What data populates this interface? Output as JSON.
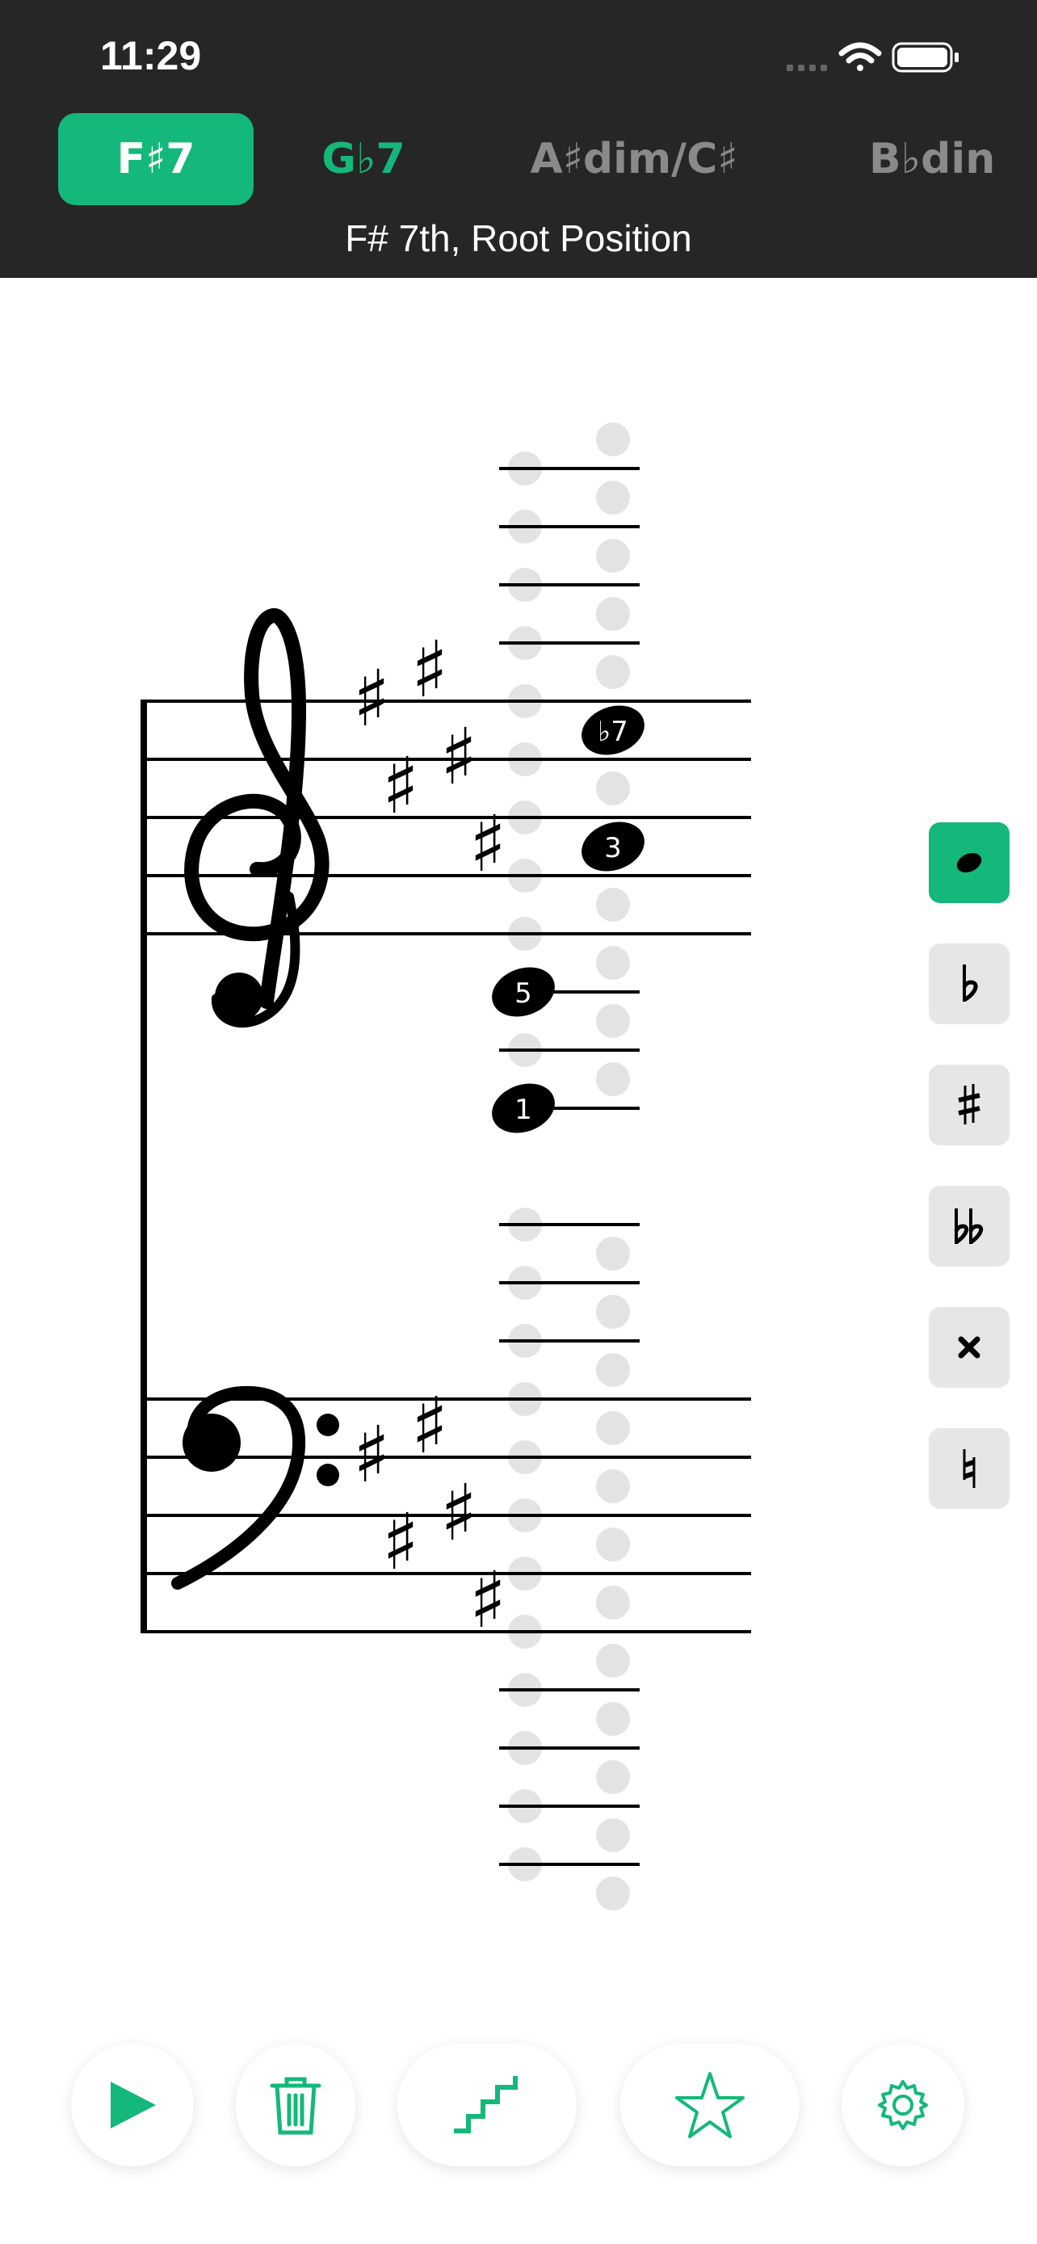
{
  "status_bar": {
    "time": "11:29"
  },
  "chord_tabs": [
    {
      "label": "F♯7",
      "state": "selected"
    },
    {
      "label": "G♭7",
      "state": "highlighted"
    },
    {
      "label": "A♯dim/C♯",
      "state": "normal"
    },
    {
      "label": "B♭din",
      "state": "normal"
    }
  ],
  "chord_description": "F# 7th, Root Position",
  "notes": [
    {
      "label": "♭7"
    },
    {
      "label": "3"
    },
    {
      "label": "5"
    },
    {
      "label": "1"
    }
  ],
  "accidental_tools": [
    {
      "name": "note",
      "active": true
    },
    {
      "name": "flat",
      "active": false
    },
    {
      "name": "sharp",
      "active": false
    },
    {
      "name": "double-flat",
      "active": false
    },
    {
      "name": "double-sharp",
      "active": false
    },
    {
      "name": "natural",
      "active": false
    }
  ],
  "toolbar": [
    "play-icon",
    "trash-icon",
    "stairs-icon",
    "star-icon",
    "gear-icon"
  ],
  "colors": {
    "accent": "#14b87a",
    "topbar": "#262626",
    "placeholder": "#e3e3e3"
  }
}
